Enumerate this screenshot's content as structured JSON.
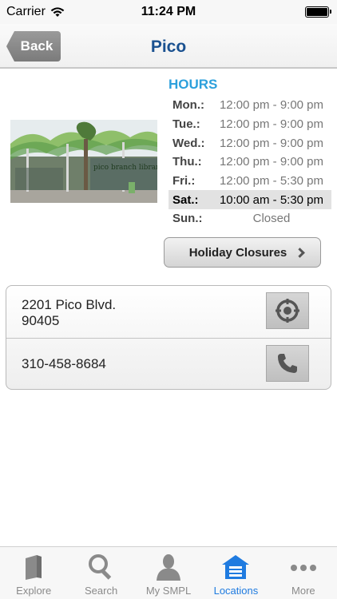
{
  "status_bar": {
    "carrier": "Carrier",
    "time": "11:24 PM"
  },
  "nav": {
    "back_label": "Back",
    "title": "Pico"
  },
  "photo": {
    "sign_text": "pico branch library"
  },
  "hours": {
    "title": "HOURS",
    "rows": [
      {
        "day": "Mon.:",
        "time": "12:00 pm - 9:00 pm"
      },
      {
        "day": "Tue.:",
        "time": "12:00 pm - 9:00 pm"
      },
      {
        "day": "Wed.:",
        "time": "12:00 pm - 9:00 pm"
      },
      {
        "day": "Thu.:",
        "time": "12:00 pm - 9:00 pm"
      },
      {
        "day": "Fri.:",
        "time": "12:00 pm - 5:30 pm"
      },
      {
        "day": "Sat.:",
        "time": "10:00 am - 5:30 pm"
      },
      {
        "day": "Sun.:",
        "time": "Closed"
      }
    ],
    "holiday_button": "Holiday Closures"
  },
  "contact": {
    "address_line1": "2201 Pico Blvd.",
    "address_line2": "90405",
    "phone": "310-458-8684"
  },
  "tabs": [
    {
      "label": "Explore",
      "icon": "book-icon"
    },
    {
      "label": "Search",
      "icon": "search-icon"
    },
    {
      "label": "My SMPL",
      "icon": "person-icon"
    },
    {
      "label": "Locations",
      "icon": "house-icon"
    },
    {
      "label": "More",
      "icon": "more-dots-icon"
    }
  ],
  "colors": {
    "accent": "#1f7be0",
    "title": "#1a5190",
    "hours_title": "#2ca0dc"
  }
}
